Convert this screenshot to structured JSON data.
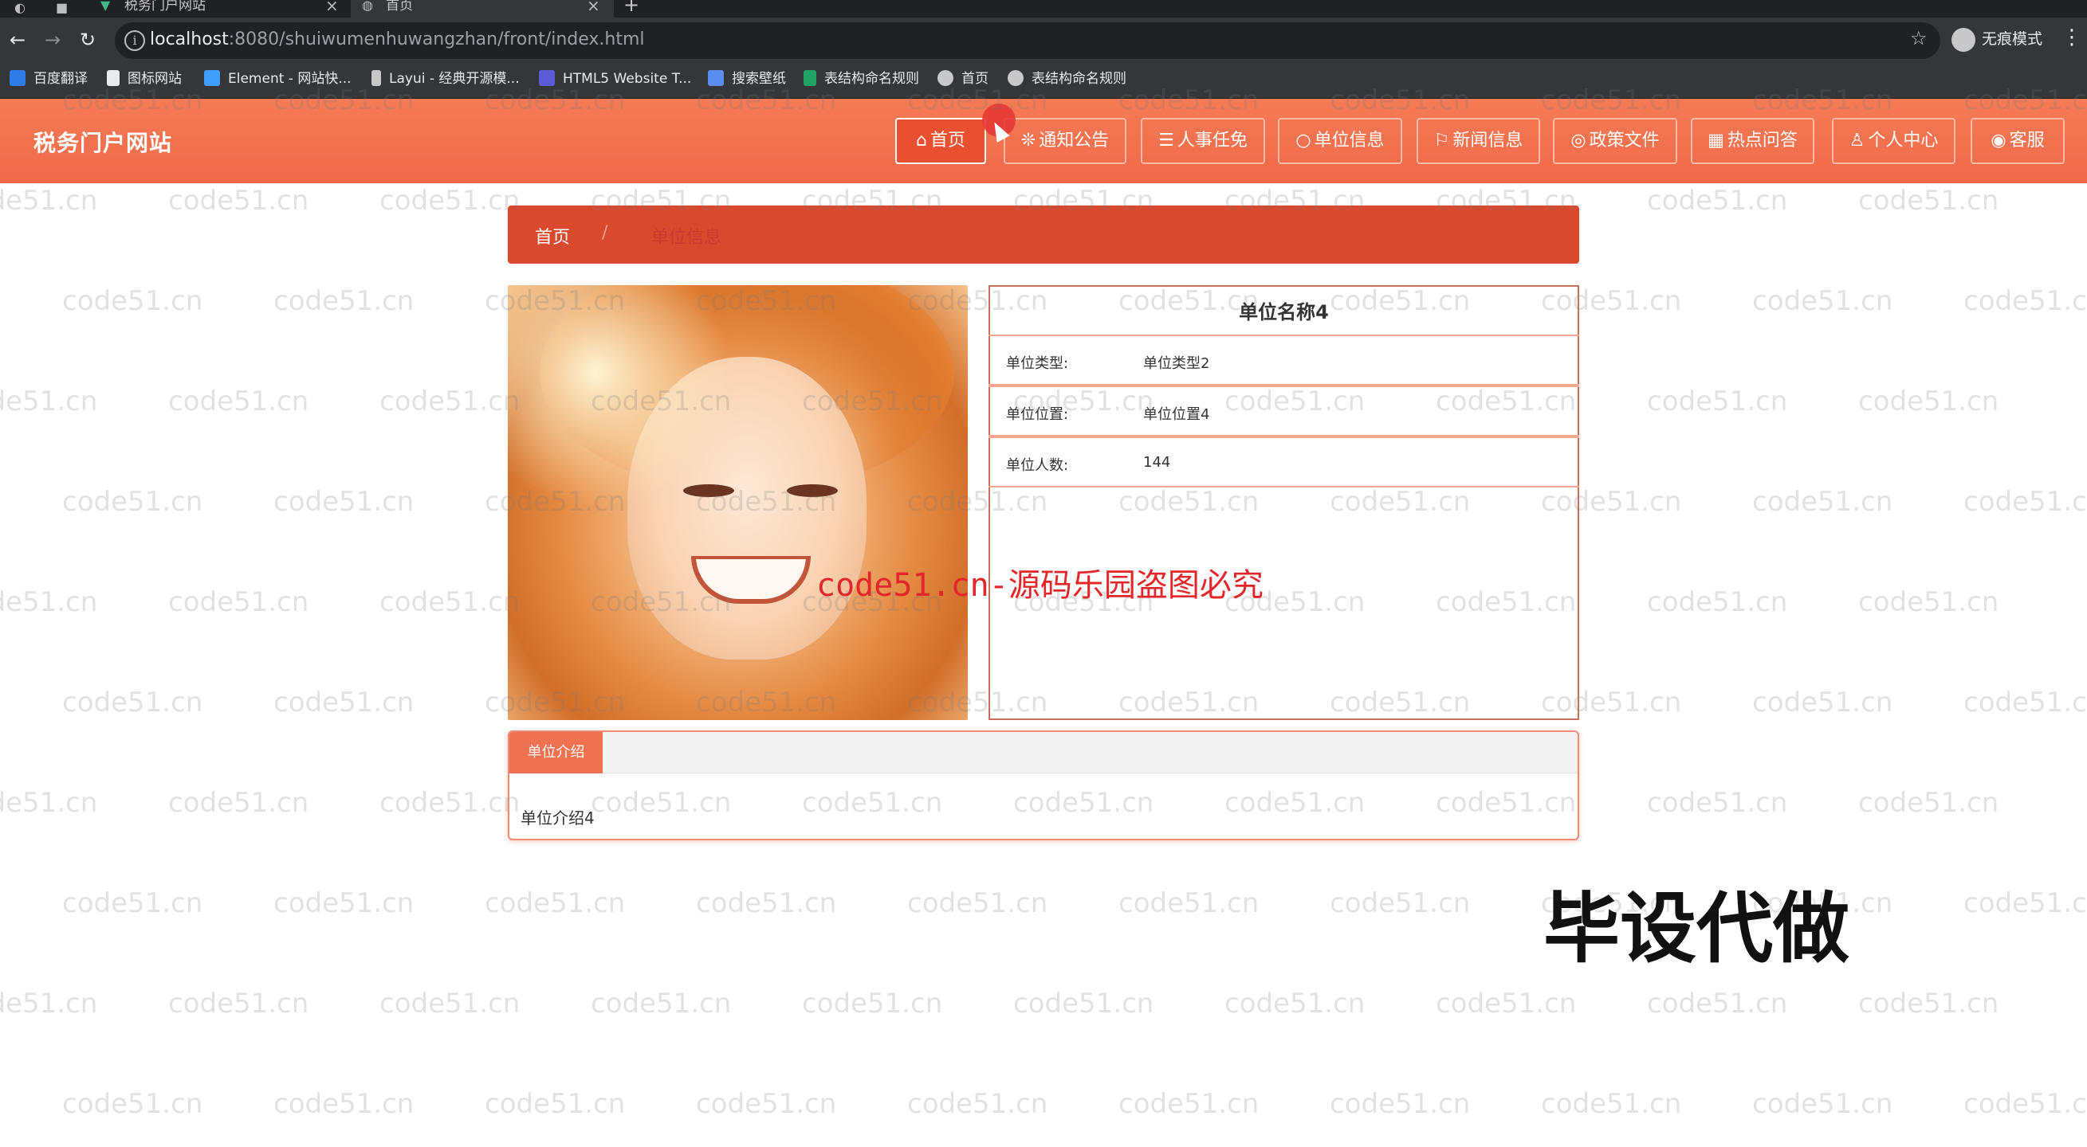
{
  "browser": {
    "tabs": [
      {
        "label": "税务门户网站",
        "active": false
      },
      {
        "label": "首页",
        "active": true
      }
    ],
    "url_host": "localhost",
    "url_rest": ":8080/shuiwumenhuwangzhan/front/index.html",
    "incognito_label": "无痕模式",
    "bookmarks": [
      {
        "label": "百度翻译",
        "icon": "translate-icon",
        "color": "#2f7be8"
      },
      {
        "label": "图标网站",
        "icon": "flag-icon",
        "color": "#e8eaed"
      },
      {
        "label": "Element - 网站快...",
        "icon": "element-icon",
        "color": "#409eff"
      },
      {
        "label": "Layui - 经典开源模...",
        "icon": "layui-icon",
        "color": "#c8c8c8"
      },
      {
        "label": "HTML5 Website T...",
        "icon": "html5-icon",
        "color": "#5b5bd6"
      },
      {
        "label": "搜索壁纸",
        "icon": "wallpaper-icon",
        "color": "#5b8def"
      },
      {
        "label": "表结构命名规则",
        "icon": "sheet-icon",
        "color": "#21a366"
      },
      {
        "label": "首页",
        "icon": "globe-icon",
        "color": "#c8c8c8"
      },
      {
        "label": "表结构命名规则",
        "icon": "globe-icon",
        "color": "#c8c8c8"
      }
    ]
  },
  "site": {
    "title": "税务门户网站",
    "nav": [
      {
        "label": "首页",
        "icon": "home-icon",
        "glyph": "⌂",
        "active": true
      },
      {
        "label": "通知公告",
        "icon": "notice-icon",
        "glyph": "❊",
        "active": false
      },
      {
        "label": "人事任免",
        "icon": "layers-icon",
        "glyph": "☰",
        "active": false
      },
      {
        "label": "单位信息",
        "icon": "circle-icon",
        "glyph": "○",
        "active": false
      },
      {
        "label": "新闻信息",
        "icon": "flag-icon",
        "glyph": "⚐",
        "active": false
      },
      {
        "label": "政策文件",
        "icon": "file-icon",
        "glyph": "◎",
        "active": false
      },
      {
        "label": "热点问答",
        "icon": "calendar-icon",
        "glyph": "▦",
        "active": false
      },
      {
        "label": "个人中心",
        "icon": "user-icon",
        "glyph": "♙",
        "active": false
      },
      {
        "label": "客服",
        "icon": "service-icon",
        "glyph": "◉",
        "active": false
      }
    ]
  },
  "breadcrumb": {
    "home": "首页",
    "separator": "/",
    "current": "单位信息"
  },
  "detail": {
    "name": "单位名称4",
    "rows": [
      {
        "label": "单位类型:",
        "value": "单位类型2"
      },
      {
        "label": "单位位置:",
        "value": "单位位置4"
      },
      {
        "label": "单位人数:",
        "value": "144"
      }
    ]
  },
  "intro": {
    "tab_label": "单位介绍",
    "body": "单位介绍4"
  },
  "watermarks": {
    "tile_text": "code51.cn",
    "center_text": "code51.cn-源码乐园盗图必究",
    "big_text": "毕设代做"
  },
  "colors": {
    "header": "#f0694a",
    "breadcrumb": "#d9492e",
    "accent": "#f07150"
  }
}
